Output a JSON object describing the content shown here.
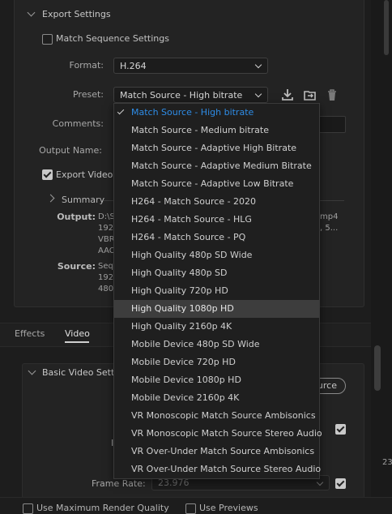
{
  "export_settings": {
    "section_title": "Export Settings",
    "match_sequence_label": "Match Sequence Settings",
    "format_label": "Format:",
    "format_value": "H.264",
    "preset_label": "Preset:",
    "preset_value": "Match Source - High bitrate",
    "comments_label": "Comments:",
    "output_name_label": "Output Name:",
    "export_video_label": "Export Video"
  },
  "summary": {
    "title": "Summary",
    "output_key": "Output:",
    "output_lines": [
      "D:\\S",
      "192",
      "VBR",
      "AAC"
    ],
    "output_right_lines": [
      "mp4",
      ", 5..."
    ],
    "source_key": "Source:",
    "source_lines": [
      "Seq",
      "192",
      "480"
    ]
  },
  "tabs": {
    "effects": "Effects",
    "video": "Video"
  },
  "video_settings": {
    "section_title": "Basic Video Setti",
    "match_source_button": "urce",
    "frame_rate_label": "Frame Rate:",
    "frame_rate_value": "23.976",
    "side_value": "23",
    "side_mark": "I"
  },
  "bottom": {
    "max_render_label": "Use Maximum Render Quality",
    "use_previews_label": "Use Previews"
  },
  "preset_menu": {
    "items": [
      "Match Source - High bitrate",
      "Match Source - Medium bitrate",
      "Match Source - Adaptive High Bitrate",
      "Match Source - Adaptive Medium Bitrate",
      "Match Source - Adaptive Low Bitrate",
      "H264 - Match Source - 2020",
      "H264 - Match Source - HLG",
      "H264 - Match Source - PQ",
      "High Quality 480p SD Wide",
      "High Quality 480p SD",
      "High Quality 720p HD",
      "High Quality 1080p HD",
      "High Quality 2160p 4K",
      "Mobile Device 480p SD Wide",
      "Mobile Device 720p HD",
      "Mobile Device 1080p HD",
      "Mobile Device 2160p 4K",
      "VR Monoscopic Match Source Ambisonics",
      "VR Monoscopic Match Source Stereo Audio",
      "VR Over-Under Match Source Ambisonics",
      "VR Over-Under Match Source Stereo Audio"
    ],
    "selected_index": 0,
    "hover_index": 11
  },
  "colors": {
    "background": "#1d1d1d",
    "panel": "#232323",
    "selected_item": "#2e8ce6",
    "hover_item": "#3d3d3d"
  },
  "icons": [
    "save-preset-icon",
    "import-preset-icon",
    "delete-preset-icon",
    "checkmark-icon",
    "chevron-down-icon"
  ]
}
